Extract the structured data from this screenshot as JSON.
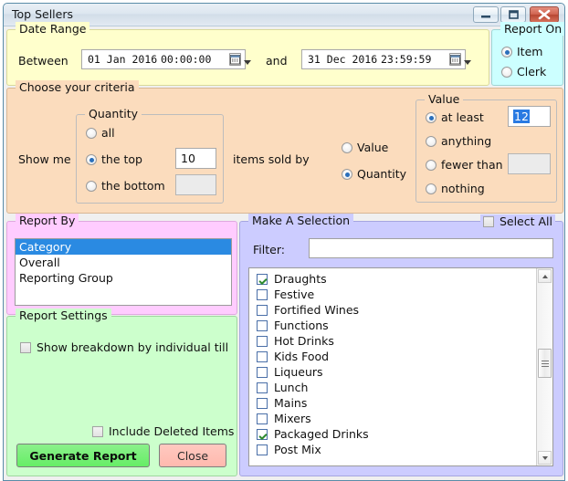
{
  "window": {
    "title": "Top Sellers",
    "buttons": {
      "minimize": "minimize-icon",
      "maximize": "maximize-icon",
      "close": "close-icon"
    }
  },
  "date_range": {
    "legend": "Date Range",
    "between_label": "Between",
    "and_label": "and",
    "from": {
      "date": "01 Jan 2016",
      "time": "00:00:00"
    },
    "to": {
      "date": "31 Dec 2016",
      "time": "23:59:59"
    }
  },
  "report_on": {
    "legend": "Report On",
    "options": [
      {
        "label": "Item",
        "selected": true
      },
      {
        "label": "Clerk",
        "selected": false
      }
    ]
  },
  "criteria": {
    "legend": "Choose your criteria",
    "show_me_label": "Show me",
    "items_sold_by_label": "items sold by",
    "quantity_group": {
      "legend": "Quantity",
      "options": [
        {
          "label": "all",
          "selected": false
        },
        {
          "label": "the top",
          "selected": true
        },
        {
          "label": "the bottom",
          "selected": false
        }
      ],
      "top_value": "10",
      "bottom_value": ""
    },
    "sort_by": [
      {
        "label": "Value",
        "selected": false
      },
      {
        "label": "Quantity",
        "selected": true
      }
    ],
    "value_group": {
      "legend": "Value",
      "options": [
        {
          "label": "at least",
          "selected": true
        },
        {
          "label": "anything",
          "selected": false
        },
        {
          "label": "fewer than",
          "selected": false
        },
        {
          "label": "nothing",
          "selected": false
        }
      ],
      "at_least_value": "12",
      "fewer_than_value": ""
    }
  },
  "report_by": {
    "legend": "Report By",
    "items": [
      {
        "label": "Category",
        "selected": true
      },
      {
        "label": "Overall",
        "selected": false
      },
      {
        "label": "Reporting Group",
        "selected": false
      }
    ]
  },
  "report_settings": {
    "legend": "Report Settings",
    "show_breakdown": {
      "label": "Show breakdown by individual till",
      "checked": false
    },
    "include_deleted": {
      "label": "Include Deleted Items",
      "checked": false
    },
    "generate_button": "Generate Report",
    "close_button": "Close"
  },
  "selection": {
    "legend": "Make A Selection",
    "select_all": {
      "label": "Select All",
      "checked": false
    },
    "filter_label": "Filter:",
    "filter_value": "",
    "filter_placeholder": "",
    "items": [
      {
        "label": "Draughts",
        "checked": true
      },
      {
        "label": "Festive",
        "checked": false
      },
      {
        "label": "Fortified Wines",
        "checked": false
      },
      {
        "label": "Functions",
        "checked": false
      },
      {
        "label": "Hot Drinks",
        "checked": false
      },
      {
        "label": "Kids Food",
        "checked": false
      },
      {
        "label": "Liqueurs",
        "checked": false
      },
      {
        "label": "Lunch",
        "checked": false
      },
      {
        "label": "Mains",
        "checked": false
      },
      {
        "label": "Mixers",
        "checked": false
      },
      {
        "label": "Packaged Drinks",
        "checked": true
      },
      {
        "label": "Post Mix",
        "checked": false
      }
    ],
    "scrollbar": {
      "up_icon": "scroll-up-icon",
      "down_icon": "scroll-down-icon"
    }
  },
  "colors": {
    "date_panel": "#ffffcc",
    "report_on_panel": "#ccffff",
    "criteria_panel": "#fbdcbd",
    "report_by_panel": "#ffccff",
    "report_settings_panel": "#ccffcc",
    "selection_panel": "#ccccff",
    "selection_highlight": "#2a8ae2",
    "generate_button": "#66ee66",
    "close_button": "#ffb9ae"
  }
}
